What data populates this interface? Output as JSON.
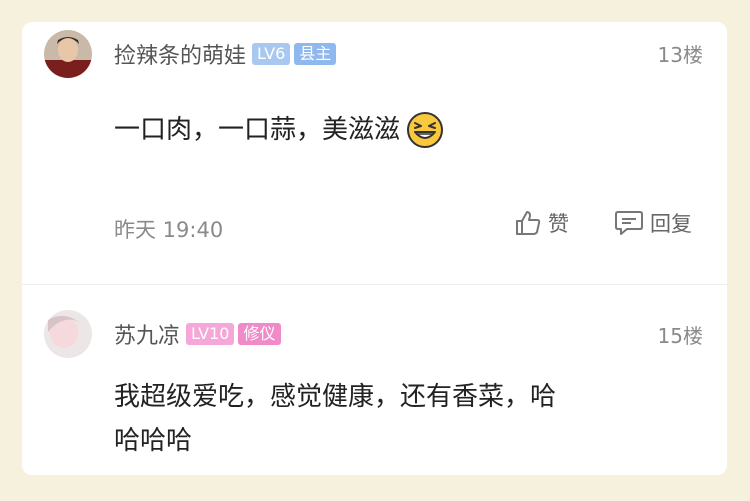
{
  "comments": [
    {
      "username": "捡辣条的萌娃",
      "level": "LV6",
      "title": "县主",
      "floor": "13楼",
      "content": "一口肉，一口蒜，美滋滋",
      "time": "昨天 19:40",
      "like_label": "赞",
      "reply_label": "回复"
    },
    {
      "username": "苏九凉",
      "level": "LV10",
      "title": "修仪",
      "floor": "15楼",
      "content_line1": "我超级爱吃，感觉健康，还有香菜，哈",
      "content_line2": "哈哈哈"
    }
  ],
  "colors": {
    "level_blue": "#a8c8f0",
    "title_blue": "#8fb8ee",
    "level_pink": "#f4a7d8",
    "title_pink": "#f08ac8"
  }
}
